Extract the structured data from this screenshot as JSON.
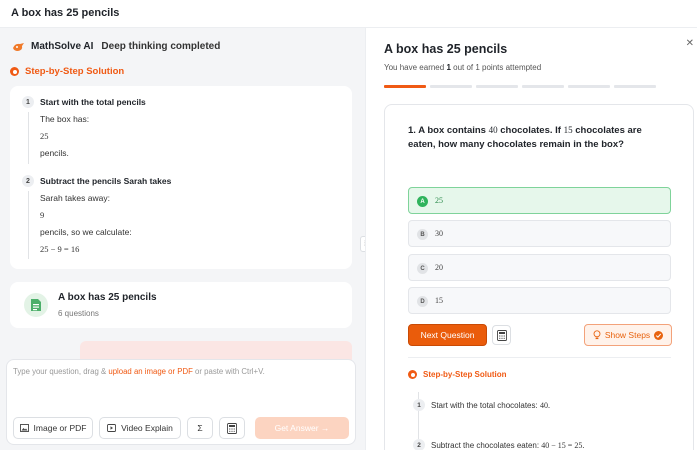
{
  "window": {
    "title": "A box has 25 pencils"
  },
  "left": {
    "brand": {
      "name": "MathSolve AI",
      "status": "Deep thinking completed"
    },
    "solution_heading": "Step-by-Step Solution",
    "steps": [
      {
        "num": "1",
        "title": "Start with the total pencils",
        "lines": [
          "The box has:",
          "25",
          "pencils."
        ]
      },
      {
        "num": "2",
        "title": "Subtract the pencils Sarah takes",
        "lines": [
          "Sarah takes away:",
          "9",
          "pencils, so we calculate:",
          "25 − 9 = 16"
        ]
      }
    ],
    "quiz": {
      "title": "A box has 25 pencils",
      "subtitle": "6 questions"
    },
    "input": {
      "placeholder_pre": "Type your question, drag & ",
      "placeholder_link": "upload an image or PDF",
      "placeholder_post": " or paste with Ctrl+V.",
      "btn_image": "Image or PDF",
      "btn_video": "Video Explain",
      "btn_sigma": "Σ",
      "btn_submit": "Get Answer →"
    }
  },
  "right": {
    "title": "A box has 25 pencils",
    "earned_pre": "You have earned ",
    "earned_value": "1",
    "earned_post": " out of 1 points attempted",
    "progress": {
      "current": 1,
      "total": 6
    },
    "question": {
      "prefix": "1. A box contains ",
      "n1": "40",
      "mid": " chocolates. If ",
      "n2": "15",
      "suffix": " chocolates are eaten, how many chocolates remain in the box?"
    },
    "options": [
      {
        "letter": "A",
        "value": "25",
        "correct": true
      },
      {
        "letter": "B",
        "value": "30",
        "correct": false
      },
      {
        "letter": "C",
        "value": "20",
        "correct": false
      },
      {
        "letter": "D",
        "value": "15",
        "correct": false
      }
    ],
    "next_label": "Next Question",
    "steps_label": "Show Steps",
    "solution_heading": "Step-by-Step Solution",
    "steps": [
      {
        "num": "1",
        "text": "Start with the total chocolates: ",
        "math": "40."
      },
      {
        "num": "2",
        "text": "Subtract the chocolates eaten: ",
        "math": "40 − 15 = 25."
      }
    ]
  },
  "colors": {
    "accent": "#f05a14",
    "correct": "#2fb35c"
  }
}
